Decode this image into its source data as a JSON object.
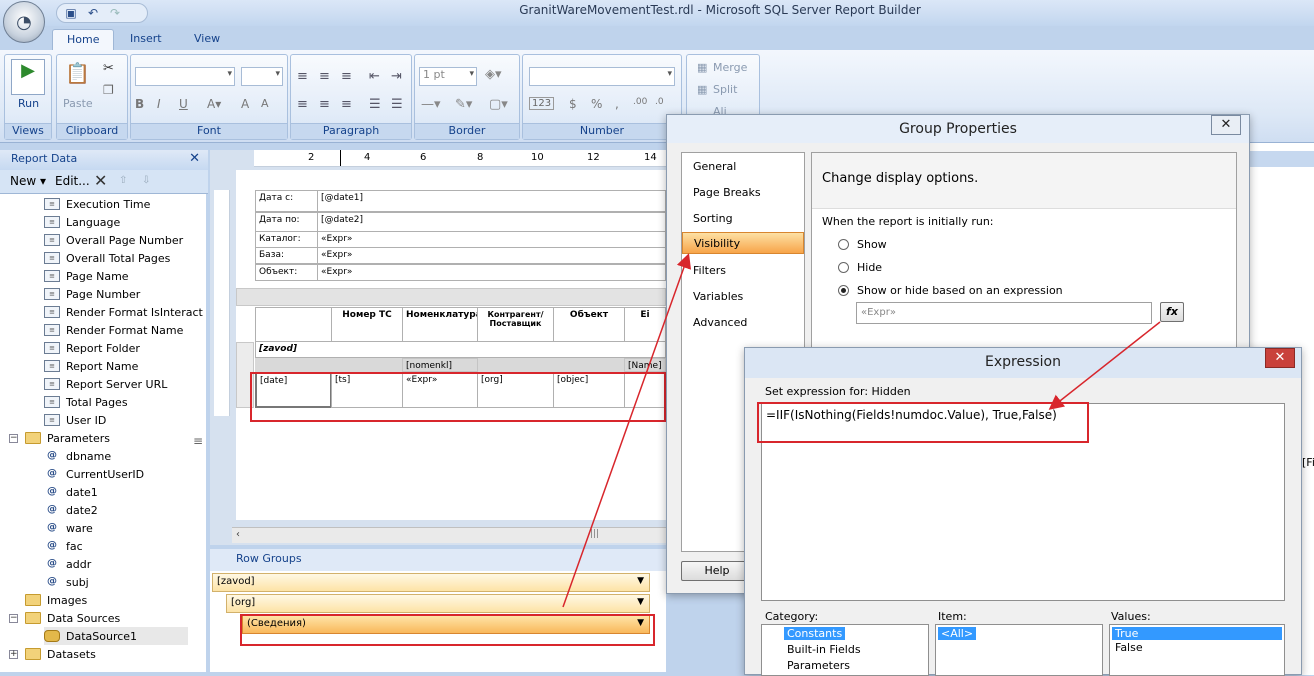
{
  "window": {
    "title": "GranitWareMovementTest.rdl - Microsoft SQL Server Report Builder"
  },
  "ribbon": {
    "tabs": [
      "Home",
      "Insert",
      "View"
    ],
    "groups": {
      "views": {
        "label": "Views",
        "run": "Run"
      },
      "clipboard": {
        "label": "Clipboard",
        "paste": "Paste"
      },
      "font": {
        "label": "Font"
      },
      "paragraph": {
        "label": "Paragraph"
      },
      "border": {
        "label": "Border",
        "size": "1 pt"
      },
      "number": {
        "label": "Number"
      },
      "layout": {
        "merge": "Merge",
        "split": "Split",
        "align": "Ali"
      }
    }
  },
  "report_data": {
    "title": "Report Data",
    "new": "New",
    "edit": "Edit...",
    "builtin": [
      "Execution Time",
      "Language",
      "Overall Page Number",
      "Overall Total Pages",
      "Page Name",
      "Page Number",
      "Render Format IsInteract",
      "Render Format Name",
      "Report Folder",
      "Report Name",
      "Report Server URL",
      "Total Pages",
      "User ID"
    ],
    "parameters_label": "Parameters",
    "parameters": [
      "dbname",
      "CurrentUserID",
      "date1",
      "date2",
      "ware",
      "fac",
      "addr",
      "subj"
    ],
    "images": "Images",
    "data_sources": "Data Sources",
    "datasource1": "DataSource1",
    "datasets": "Datasets"
  },
  "ruler": [
    "2",
    "4",
    "6",
    "8",
    "10",
    "12",
    "14"
  ],
  "report": {
    "header": [
      {
        "label": "Дата с:",
        "value": "[@date1]"
      },
      {
        "label": "Дата по:",
        "value": "[@date2]"
      },
      {
        "label": "Каталог:",
        "value": "«Expr»"
      },
      {
        "label": "База:",
        "value": "«Expr»"
      },
      {
        "label": "Объект:",
        "value": "«Expr»"
      }
    ],
    "columns": [
      "Номер ТС",
      "Номенклатура",
      "Контрагент/Поставщик",
      "Объект",
      "Ei"
    ],
    "group_row": "[zavod]",
    "subrow": [
      "[nomenkl]",
      "[Name]"
    ],
    "detail": [
      "[date]",
      "[ts]",
      "«Expr»",
      "[org]",
      "[objec]"
    ]
  },
  "row_groups": {
    "title": "Row Groups",
    "items": [
      "[zavod]",
      "[org]",
      "(Сведения)"
    ]
  },
  "group_properties": {
    "title": "Group Properties",
    "nav": [
      "General",
      "Page Breaks",
      "Sorting",
      "Visibility",
      "Filters",
      "Variables",
      "Advanced"
    ],
    "selected": "Visibility",
    "heading": "Change display options.",
    "prompt": "When the report is initially run:",
    "options": [
      "Show",
      "Hide",
      "Show or hide based on an expression"
    ],
    "selected_option": "Show or hide based on an expression",
    "expr_placeholder": "«Expr»",
    "fx": "fx",
    "help": "Help"
  },
  "expression": {
    "title": "Expression",
    "set_for": "Set expression for: Hidden",
    "value": "=IIF(IsNothing(Fields!numdoc.Value), True,False)",
    "category_label": "Category:",
    "categories": [
      "Constants",
      "Built-in Fields",
      "Parameters"
    ],
    "item_label": "Item:",
    "items": [
      "<All>"
    ],
    "values_label": "Values:",
    "values": [
      "True",
      "False"
    ]
  },
  "right_edge": {
    "text": "[Fi"
  },
  "colors": {
    "accent": "#d8262c",
    "selection": "#3399ff",
    "ribbon": "#dde8f6"
  }
}
